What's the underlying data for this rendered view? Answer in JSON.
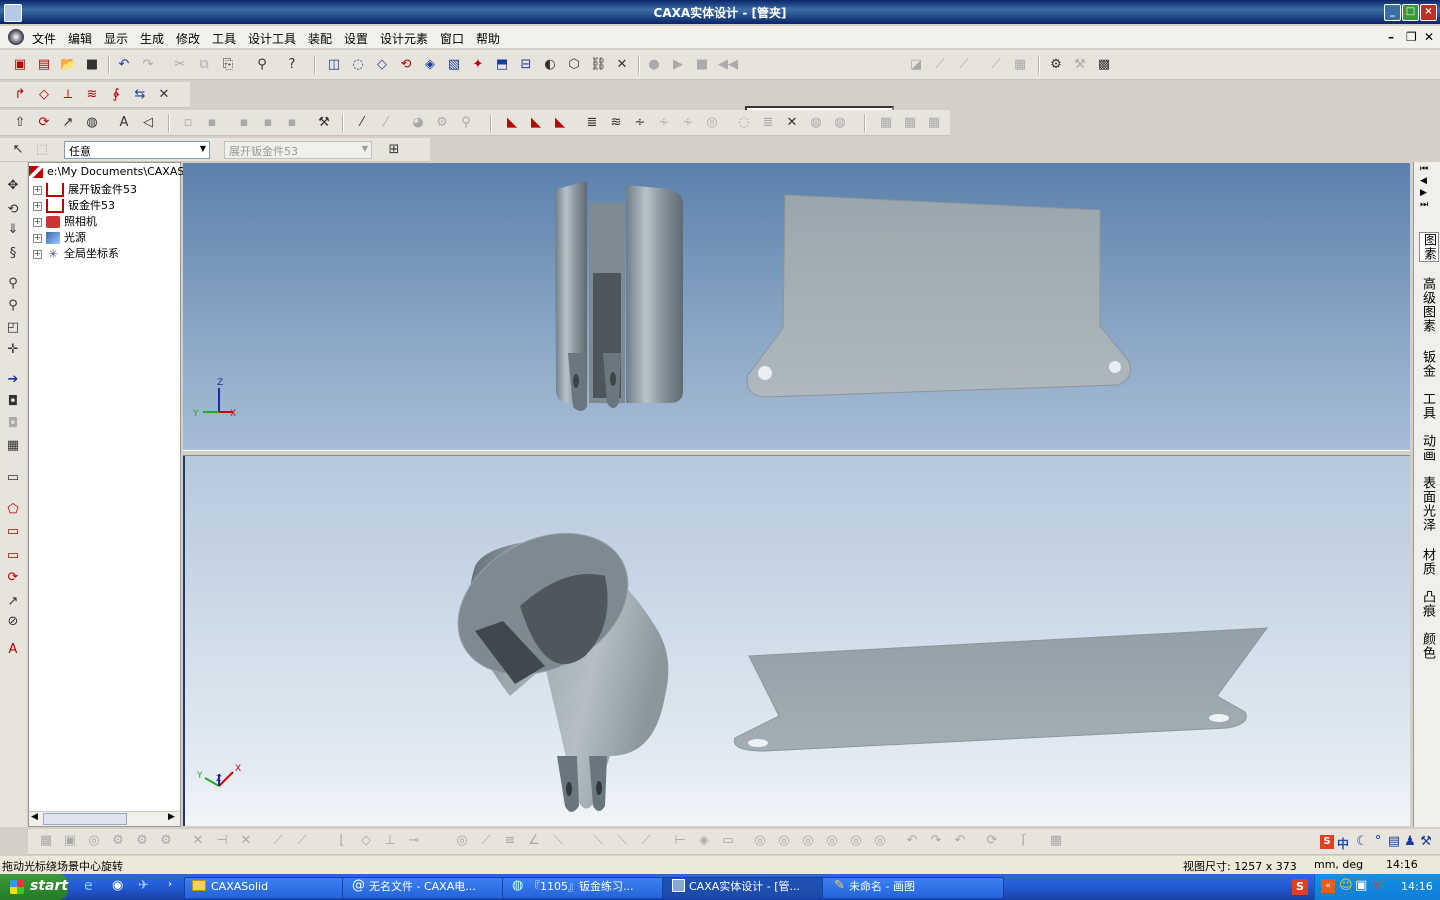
{
  "window": {
    "title": "CAXA实体设计 - [管夹]",
    "min": "_",
    "max": "□",
    "close": "×"
  },
  "menu": [
    "文件",
    "编辑",
    "显示",
    "生成",
    "修改",
    "工具",
    "设计工具",
    "装配",
    "设置",
    "设计元素",
    "窗口",
    "帮助"
  ],
  "selector": {
    "mode": "任意",
    "part": "展开钣金件53"
  },
  "tree": {
    "root": "e:\\My Documents\\CAXASc",
    "items": [
      "展开钣金件53",
      "钣金件53",
      "照相机",
      "光源",
      "全局坐标系"
    ]
  },
  "right_tabs": [
    "图素",
    "高级图素",
    "钣金",
    "工具",
    "动画",
    "表面光泽",
    "材质",
    "凸痕",
    "颜色"
  ],
  "axes": {
    "top": {
      "z": "Z",
      "x": "X",
      "y": "Y"
    },
    "bottom": {
      "x": "X",
      "y": "Y",
      "z": "Z"
    }
  },
  "status": {
    "message": "拖动光标绕场景中心旋转",
    "view_size": "视图尺寸: 1257 x 373",
    "units": "mm, deg",
    "time": "14:16"
  },
  "ime": {
    "lang": "中"
  },
  "taskbar": {
    "start": "start",
    "tasks": [
      "CAXASolid",
      "无名文件 - CAXA电...",
      "『1105』钣金练习...",
      "CAXA实体设计 - [管...",
      "未命名 - 画图"
    ],
    "clock": "14:16"
  },
  "colors": {
    "titlebar": "#0a246a",
    "viewport_top": "#5b80ab",
    "viewport_bottom": "#e4ecf3",
    "taskbar": "#245edb",
    "part": "#8a9aa4"
  }
}
